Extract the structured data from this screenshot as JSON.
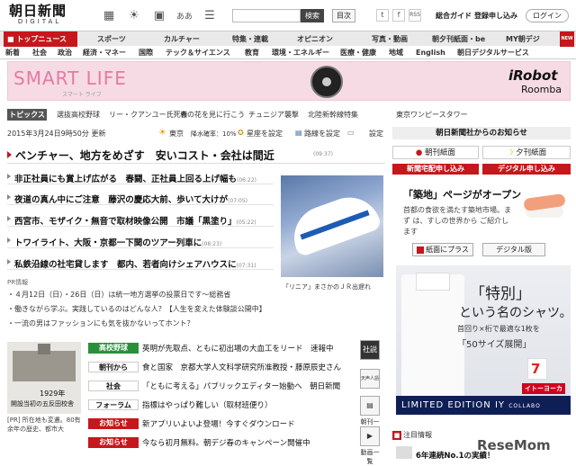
{
  "header": {
    "logo_main": "朝日新聞",
    "logo_sub": "DIGITAL",
    "search_button": "検索",
    "search_placeholder": "",
    "toc_button": "目次",
    "guide_link": "総合ガイド",
    "register_link": "登録申し込み",
    "login_button": "ログイン",
    "icons": [
      "news-icon",
      "weather-icon",
      "tv-icon",
      "font-size-icon",
      "list-icon"
    ],
    "font_icon_text": "ああ",
    "sns": [
      "t",
      "f",
      "RSS"
    ]
  },
  "nav": {
    "home": "トップニュース",
    "items": [
      "スポーツ",
      "カルチャー",
      "特集・連載",
      "オピニオン",
      "写真・動画",
      "朝夕刊紙面・be",
      "MY朝デジ"
    ],
    "new_badge": "NEW"
  },
  "subnav": {
    "items": [
      "新着",
      "社会",
      "政治",
      "経済・マネー",
      "国際",
      "テック＆サイエンス",
      "教育",
      "環境・エネルギー",
      "医療・健康",
      "地域",
      "English",
      "朝日デジタルサービス"
    ]
  },
  "banner": {
    "title": "SMART LIFE",
    "subtitle": "スマート ライフ",
    "brand": "iRobot",
    "product": "Roomba"
  },
  "topics": {
    "label": "トピックス",
    "items": [
      "選抜高校野球",
      "リー・クアンユー氏死去",
      "春の花を見に行こう",
      "チュニジア襲撃",
      "北陸新幹線特集",
      "東京ワンピースタワー"
    ]
  },
  "update": {
    "text": "2015年3月24日9時50分 更新",
    "weather_city": "東京",
    "rain": "降水確率：10%",
    "horoscope": "星座を設定",
    "route": "路線を設定",
    "settings": "設定"
  },
  "lead": {
    "title": "ベンチャー、地方をめざす　安いコスト・会社は間近",
    "time": "(09:37)"
  },
  "headlines": [
    {
      "text": "非正社員にも賞上げ広がる　春闘、正社員上回る上げ幅も",
      "time": "(06:22)"
    },
    {
      "text": "夜道の真ん中にご注意　藤沢の慶応大前、歩いて大けが",
      "time": "(07:05)"
    },
    {
      "text": "西宮市、モザイク・無音で取材映像公開　市議「黒塗り」",
      "time": "(05:22)"
    },
    {
      "text": "トワイライト、大阪・京都一下関のツアー列車に",
      "time": "(08:23)"
    },
    {
      "text": "私鉄沿線の社宅貸します　都内、若者向けシェアハウスに",
      "time": "(07:31)"
    }
  ],
  "photo": {
    "caption": "「リニア」まさかのＪＲ出遅れ"
  },
  "pr": {
    "label": "PR情報",
    "items": [
      "４月12日（日）・26日（日）は統一地方選挙の投票日です～総務省",
      "働きながら学ぶ。実践しているのはどんな人？【人生を変えた体験談公開中】",
      "一流の男はファッションにも気を抜かないってホント？"
    ]
  },
  "lower_photo": {
    "label_year": "1929年",
    "label_place": "開設当初の五反田校舎",
    "caption": "[PR] 所在地も変遷。80有余年の歴史、都市大"
  },
  "sections": [
    {
      "tag": "高校野球",
      "tag_color": "#2a8f3a",
      "text": "英明が先取点、ともに初出場の大血工をリード　速報中"
    },
    {
      "tag": "朝刊から",
      "tag_color": "#ffffff",
      "text": "食と国家　京都大学人文科学研究所准教授・藤原辰史さん"
    },
    {
      "tag": "社会",
      "tag_color": "#ffffff",
      "text": "「ともに考える」パブリックエディター始動へ　朝日新聞"
    },
    {
      "tag": "フォーラム",
      "tag_color": "#ffffff",
      "text": "指標はやっぱり難しい（取材班便り）"
    },
    {
      "tag": "お知らせ",
      "tag_color": "#c6171c",
      "text": "新アプリいよいよ登場！今すぐダウンロード"
    },
    {
      "tag": "お知らせ",
      "tag_color": "#c6171c",
      "text": "今なら初月無料。朝デジ春のキャンペーン開催中"
    }
  ],
  "side_buttons": [
    {
      "icon_text": "社説",
      "label": ""
    },
    {
      "icon_text": "天声人語",
      "label": ""
    },
    {
      "icon_text": "",
      "label": "朝刊一覧"
    },
    {
      "icon_text": "",
      "label": "動画一覧"
    }
  ],
  "right": {
    "heading": "朝日新聞社からのお知らせ",
    "morning": "朝刊紙面",
    "evening": "夕刊紙面",
    "subscribe_home": "新聞宅配申し込み",
    "subscribe_digital": "デジタル申し込み",
    "tsukiji_title": "「築地」ページがオープン",
    "tsukiji_text": "首都の食欲を満たす築地市場。まず は、すしの世界から ご紹介します",
    "plus_button": "紙面にプラス",
    "digital_button": "デジタル版",
    "ad_title": "「特別」",
    "ad_sub": "という名のシャツ。",
    "ad_line1": "首回り×桁で最適な1枚を",
    "ad_line2": "「50サイズ展開」",
    "ad_store": "イトーヨーカドー",
    "ad_limited": "LIMITED EDITION IY",
    "ad_collabo": "COLLABO",
    "notice_label": "注目情報",
    "notice_headline": "6年連続No.1の実績！",
    "watermark": "ReseMom"
  }
}
